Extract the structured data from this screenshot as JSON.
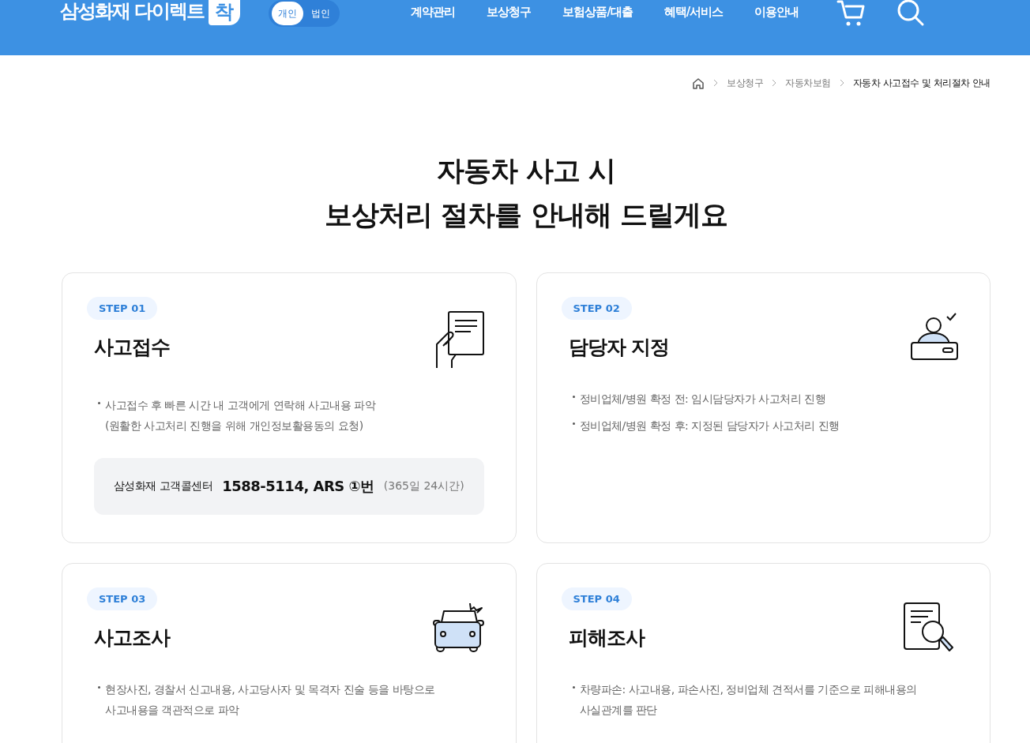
{
  "header": {
    "logo": "삼성화재 다이렉트",
    "logo_badge": "착",
    "customer_toggle": [
      {
        "label": "개인",
        "selected": true
      },
      {
        "label": "법인",
        "selected": false
      }
    ],
    "nav": [
      "계약관리",
      "보상청구",
      "보험상품/대출",
      "혜택/서비스",
      "이용안내"
    ]
  },
  "breadcrumb": [
    "보상청구",
    "자동차보험",
    "자동차 사고접수 및 처리절차 안내"
  ],
  "title_lines": [
    "자동차 사고 시",
    "보상처리 절차를 안내해 드릴게요"
  ],
  "steps": [
    {
      "step": "STEP 01",
      "title": "사고접수",
      "kind": "document",
      "bullets": [
        "사고접수 후 빠른 시간 내 고객에게 연락해 사고내용 파악\n(원활한 사고처리 진행을 위해 개인정보활용동의 요청)"
      ],
      "contact": {
        "label": "삼성화재 고객콜센터",
        "number": "1588-5114, ARS ①번",
        "hours": "(365일 24시간)"
      }
    },
    {
      "step": "STEP 02",
      "title": "담당자 지정",
      "kind": "agent",
      "bullets": [
        "정비업체/병원 확정 전: 임시담당자가 사고처리 진행",
        "정비업체/병원 확정 후: 지정된 담당자가 사고처리 진행"
      ]
    },
    {
      "step": "STEP 03",
      "title": "사고조사",
      "kind": "car",
      "bullets": [
        "현장사진, 경찰서 신고내용, 사고당사자 및 목격자 진술 등을 바탕으로\n사고내용을 객관적으로 파악"
      ]
    },
    {
      "step": "STEP 04",
      "title": "피해조사",
      "kind": "inspect",
      "bullets": [
        "차량파손: 사고내용, 파손사진, 정비업체 견적서를 기준으로 피해내용의\n사실관계를 판단"
      ]
    }
  ]
}
